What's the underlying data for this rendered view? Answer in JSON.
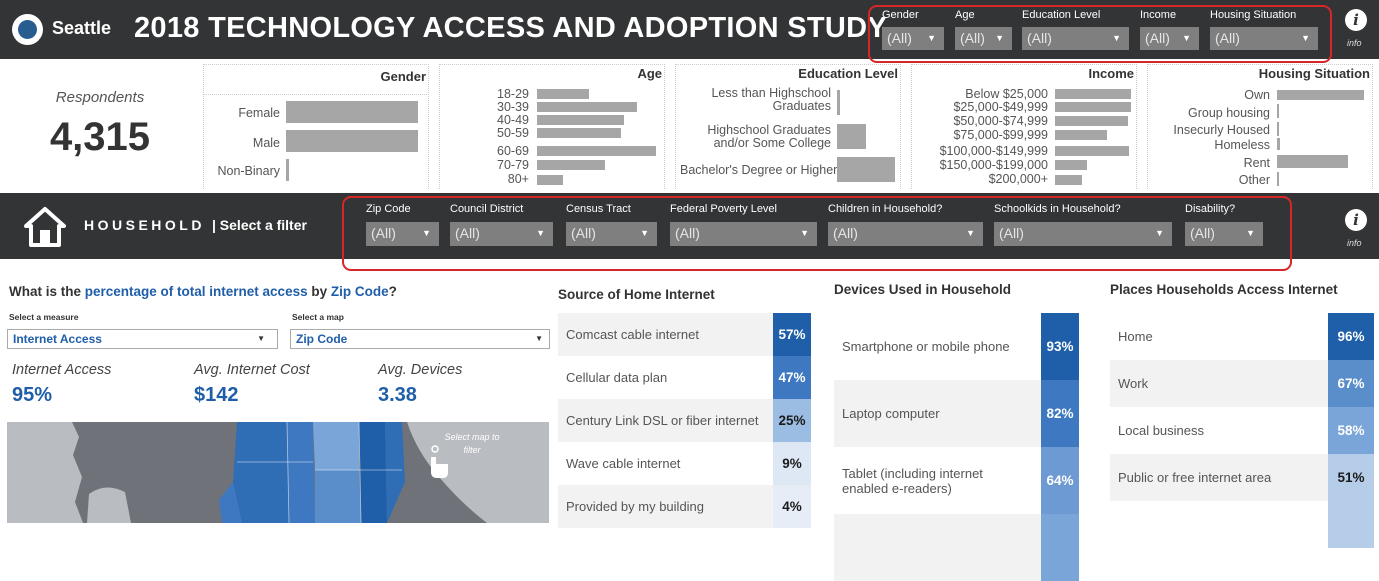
{
  "header": {
    "brand": "Seattle",
    "title": "2018 TECHNOLOGY ACCESS AND ADOPTION STUDY",
    "info": "info"
  },
  "top_filters": [
    {
      "label": "Gender",
      "value": "(All)"
    },
    {
      "label": "Age",
      "value": "(All)"
    },
    {
      "label": "Education Level",
      "value": "(All)"
    },
    {
      "label": "Income",
      "value": "(All)"
    },
    {
      "label": "Housing Situation",
      "value": "(All)"
    }
  ],
  "respondents": {
    "label": "Respondents",
    "value": "4,315"
  },
  "demographics": {
    "gender": {
      "title": "Gender",
      "items": [
        {
          "label": "Female",
          "value": 0.99
        },
        {
          "label": "Male",
          "value": 0.99
        },
        {
          "label": "Non-Binary",
          "value": 0.02
        }
      ]
    },
    "age": {
      "title": "Age",
      "items": [
        {
          "label": "18-29",
          "value": 0.44
        },
        {
          "label": "30-39",
          "value": 0.84
        },
        {
          "label": "40-49",
          "value": 0.73
        },
        {
          "label": "50-59",
          "value": 0.71
        },
        {
          "label": "60-69",
          "value": 1.0
        },
        {
          "label": "70-79",
          "value": 0.57
        },
        {
          "label": "80+",
          "value": 0.22
        }
      ]
    },
    "education": {
      "title": "Education Level",
      "items": [
        {
          "label": "Less than Highschool Graduates",
          "value": 0.06
        },
        {
          "label": "Highschool Graduates and/or Some College",
          "value": 0.5
        },
        {
          "label": "Bachelor's Degree or Higher",
          "value": 1.0
        }
      ]
    },
    "income": {
      "title": "Income",
      "items": [
        {
          "label": "Below $25,000",
          "value": 1.0
        },
        {
          "label": "$25,000-$49,999",
          "value": 1.0
        },
        {
          "label": "$50,000-$74,999",
          "value": 0.96
        },
        {
          "label": "$75,000-$99,999",
          "value": 0.68
        },
        {
          "label": "$100,000-$149,999",
          "value": 0.98
        },
        {
          "label": "$150,000-$199,000",
          "value": 0.42
        },
        {
          "label": "$200,000+",
          "value": 0.36
        }
      ]
    },
    "housing": {
      "title": "Housing Situation",
      "items": [
        {
          "label": "Own",
          "value": 1.0
        },
        {
          "label": "Group housing",
          "value": 0.01
        },
        {
          "label": "Insecurly Housed",
          "value": 0.01
        },
        {
          "label": "Homeless",
          "value": 0.03
        },
        {
          "label": "Rent",
          "value": 0.82
        },
        {
          "label": "Other",
          "value": 0.01
        }
      ]
    }
  },
  "household": {
    "label": "HOUSEHOLD",
    "select": "| Select a filter",
    "info": "info",
    "filters": [
      {
        "label": "Zip Code",
        "value": "(All)"
      },
      {
        "label": "Council District",
        "value": "(All)"
      },
      {
        "label": "Census Tract",
        "value": "(All)"
      },
      {
        "label": "Federal Poverty Level",
        "value": "(All)"
      },
      {
        "label": "Children in Household?",
        "value": "(All)"
      },
      {
        "label": "Schoolkids in Household?",
        "value": "(All)"
      },
      {
        "label": "Disability?",
        "value": "(All)"
      }
    ]
  },
  "question": {
    "pre": "What is the ",
    "measure": "percentage of total internet access",
    "mid": " by ",
    "geo": "Zip Code",
    "post": "?"
  },
  "selectors": {
    "measure_label": "Select a measure",
    "measure_value": "Internet Access",
    "map_label": "Select a map",
    "map_value": "Zip Code"
  },
  "kpis": [
    {
      "label": "Internet Access",
      "value": "95%"
    },
    {
      "label": "Avg. Internet Cost",
      "value": "$142"
    },
    {
      "label": "Avg. Devices",
      "value": "3.38"
    }
  ],
  "map": {
    "hint": "Select map to filter"
  },
  "source": {
    "title": "Source of Home Internet",
    "rows": [
      {
        "label": "Comcast cable internet",
        "value": "57%"
      },
      {
        "label": "Cellular data plan",
        "value": "47%"
      },
      {
        "label": "Century Link DSL or fiber internet",
        "value": "25%"
      },
      {
        "label": "Wave cable internet",
        "value": "9%"
      },
      {
        "label": "Provided by my building",
        "value": "4%"
      }
    ]
  },
  "devices": {
    "title": "Devices Used in Household",
    "rows": [
      {
        "label": "Smartphone or mobile phone",
        "value": "93%"
      },
      {
        "label": "Laptop computer",
        "value": "82%"
      },
      {
        "label": "Tablet (including internet enabled e-readers)",
        "value": "64%"
      }
    ]
  },
  "places": {
    "title": "Places Households Access Internet",
    "rows": [
      {
        "label": "Home",
        "value": "96%"
      },
      {
        "label": "Work",
        "value": "67%"
      },
      {
        "label": "Local business",
        "value": "58%"
      },
      {
        "label": "Public or free internet area",
        "value": "51%"
      }
    ]
  },
  "colors": {
    "dark_blue": "#1f5ea8",
    "mid_blue": "#3d78c0",
    "light_blue": "#7aa5d8",
    "pale_blue": "#b5cde8",
    "accent_red": "#d62728"
  }
}
